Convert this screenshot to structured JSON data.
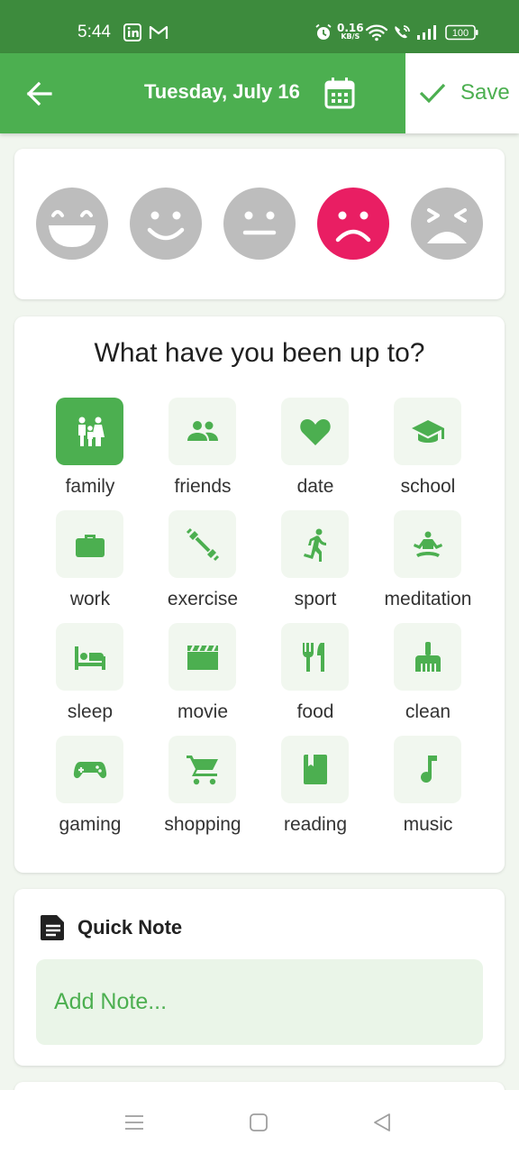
{
  "status_bar": {
    "time": "5:44",
    "net_speed_value": "0.16",
    "net_speed_unit": "KB/S",
    "battery": "100",
    "icons": [
      "linkedin-icon",
      "gmail-icon",
      "alarm-icon",
      "wifi-icon",
      "wifi-call-icon",
      "signal-icon",
      "battery-icon"
    ]
  },
  "app_bar": {
    "back_icon": "arrow-left-icon",
    "date": "Tuesday, July 16",
    "calendar_icon": "calendar-icon",
    "save_label": "Save",
    "save_icon": "check-icon"
  },
  "moods": [
    {
      "name": "rad",
      "icon": "grin-face-icon",
      "selected": false
    },
    {
      "name": "good",
      "icon": "smile-face-icon",
      "selected": false
    },
    {
      "name": "meh",
      "icon": "neutral-face-icon",
      "selected": false
    },
    {
      "name": "bad",
      "icon": "sad-face-icon",
      "selected": true
    },
    {
      "name": "awful",
      "icon": "tired-face-icon",
      "selected": false
    }
  ],
  "activities": {
    "title": "What have you been up to?",
    "items": [
      {
        "label": "family",
        "icon": "family-icon",
        "selected": true
      },
      {
        "label": "friends",
        "icon": "people-icon",
        "selected": false
      },
      {
        "label": "date",
        "icon": "heart-icon",
        "selected": false
      },
      {
        "label": "school",
        "icon": "graduation-cap-icon",
        "selected": false
      },
      {
        "label": "work",
        "icon": "briefcase-icon",
        "selected": false
      },
      {
        "label": "exercise",
        "icon": "dumbbell-icon",
        "selected": false
      },
      {
        "label": "sport",
        "icon": "running-icon",
        "selected": false
      },
      {
        "label": "meditation",
        "icon": "meditation-icon",
        "selected": false
      },
      {
        "label": "sleep",
        "icon": "bed-icon",
        "selected": false
      },
      {
        "label": "movie",
        "icon": "clapperboard-icon",
        "selected": false
      },
      {
        "label": "food",
        "icon": "restaurant-icon",
        "selected": false
      },
      {
        "label": "clean",
        "icon": "broom-icon",
        "selected": false
      },
      {
        "label": "gaming",
        "icon": "gamepad-icon",
        "selected": false
      },
      {
        "label": "shopping",
        "icon": "cart-icon",
        "selected": false
      },
      {
        "label": "reading",
        "icon": "book-icon",
        "selected": false
      },
      {
        "label": "music",
        "icon": "music-note-icon",
        "selected": false
      }
    ]
  },
  "quick_note": {
    "icon": "document-icon",
    "title": "Quick Note",
    "placeholder": "Add Note...",
    "value": ""
  },
  "nav_bar": {
    "icons": [
      "menu-icon",
      "home-icon",
      "back-triangle-icon"
    ]
  },
  "colors": {
    "primary": "#4caf50",
    "status_bar": "#3d8b3d",
    "mood_selected": "#e91e63",
    "mood_unselected": "#bdbdbd",
    "tile_bg": "#f1f7ef",
    "note_bg": "#eaf5e8"
  }
}
